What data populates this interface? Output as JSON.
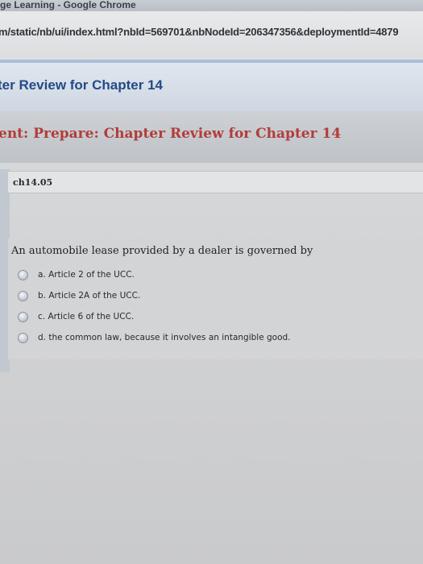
{
  "browser": {
    "window_title": "ge Learning - Google Chrome",
    "url": "m/static/nb/ui/index.html?nbId=569701&nbNodeId=206347356&deploymentId=4879"
  },
  "header": {
    "page_title": "ter Review for Chapter 14",
    "assignment_title": "ent: Prepare: Chapter Review for Chapter 14"
  },
  "question": {
    "id": "ch14.05",
    "text": "An automobile lease provided by a dealer is governed by",
    "options": [
      {
        "label": "a. Article 2 of the UCC."
      },
      {
        "label": "b. Article 2A of the UCC."
      },
      {
        "label": "c. Article 6 of the UCC."
      },
      {
        "label": "d. the common law, because it involves an intangible good."
      }
    ]
  },
  "colors": {
    "page_title": "#224b86",
    "assignment_title": "#b13d3a"
  },
  "icons": {
    "option_radio": "radio-button-icon"
  }
}
